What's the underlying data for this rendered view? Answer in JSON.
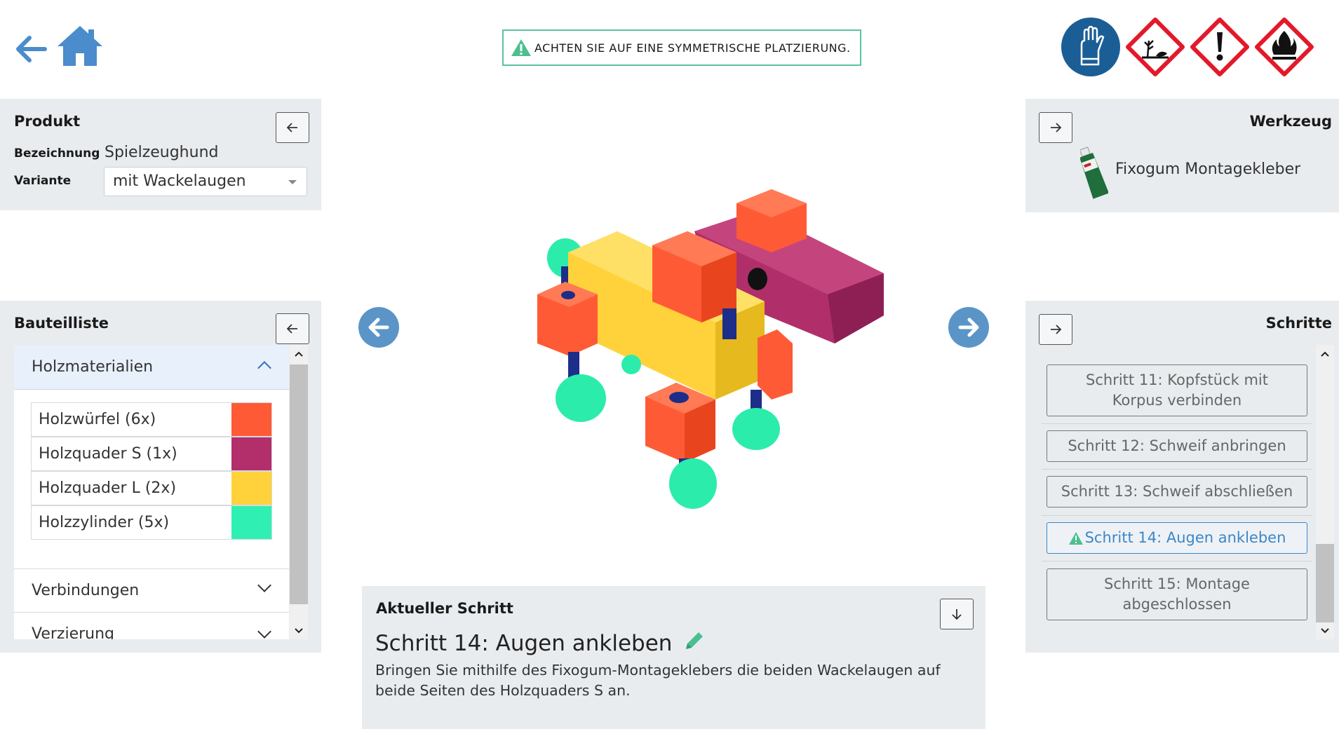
{
  "header": {
    "warning_text": "ACHTEN SIE AUF EINE SYMMETRISCHE PLATZIERUNG."
  },
  "hazards": [
    "gloves-icon",
    "environment-hazard-icon",
    "exclamation-hazard-icon",
    "flammable-hazard-icon"
  ],
  "product": {
    "title": "Produkt",
    "designation_label": "Bezeichnung",
    "designation_value": "Spielzeughund",
    "variant_label": "Variante",
    "variant_value": "mit Wackelaugen"
  },
  "tools": {
    "title": "Werkzeug",
    "item_label": "Fixogum Montagekleber"
  },
  "parts": {
    "title": "Bauteilliste",
    "sections": [
      {
        "label": "Holzmaterialien",
        "open": true
      },
      {
        "label": "Verbindungen",
        "open": false
      },
      {
        "label": "Verzierung",
        "open": false
      }
    ],
    "items": [
      {
        "label": "Holzwürfel (6x)",
        "color": "#ff5a36"
      },
      {
        "label": "Holzquader S (1x)",
        "color": "#b22f6b"
      },
      {
        "label": "Holzquader L (2x)",
        "color": "#ffd23b"
      },
      {
        "label": "Holzzylinder (5x)",
        "color": "#2ff0b2"
      }
    ]
  },
  "steps": {
    "title": "Schritte",
    "items": [
      {
        "label": "Schritt 11: Kopfstück mit Korpus verbinden",
        "active": false
      },
      {
        "label": "Schritt 12: Schweif anbringen",
        "active": false
      },
      {
        "label": "Schritt 13: Schweif abschließen",
        "active": false
      },
      {
        "label": "Schritt 14: Augen ankleben",
        "active": true
      },
      {
        "label": "Schritt 15: Montage abgeschlossen",
        "active": false
      }
    ]
  },
  "current_step": {
    "heading": "Aktueller Schritt",
    "title": "Schritt 14: Augen ankleben",
    "description": "Bringen Sie mithilfe des Fixogum-Montageklebers die beiden Wackelaugen auf beide Seiten des Holzquaders S an."
  },
  "colors": {
    "accent": "#5b95c8",
    "warning_green": "#5cc39a",
    "panel_bg": "#e9ecef"
  }
}
